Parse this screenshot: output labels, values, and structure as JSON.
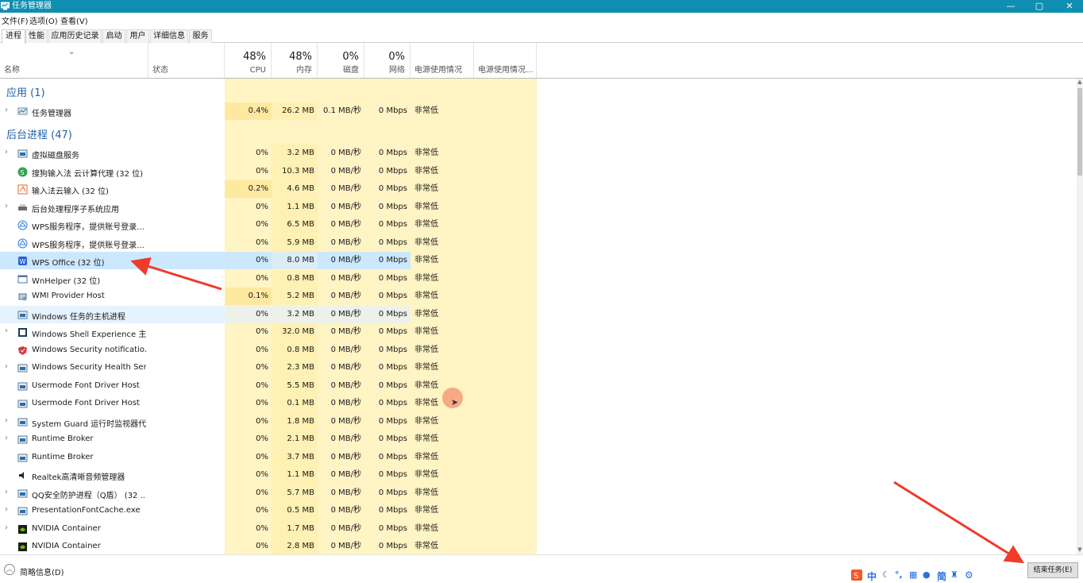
{
  "window": {
    "title": "任务管理器",
    "minimize": "—",
    "maximize": "▢",
    "close": "✕"
  },
  "menu": [
    "文件(F)",
    "选项(O)",
    "查看(V)"
  ],
  "tabs": [
    "进程",
    "性能",
    "应用历史记录",
    "启动",
    "用户",
    "详细信息",
    "服务"
  ],
  "active_tab": "进程",
  "columns": {
    "name": "名称",
    "status": "状态",
    "cpu": {
      "pct": "48%",
      "label": "CPU"
    },
    "memory": {
      "pct": "48%",
      "label": "内存"
    },
    "disk": {
      "pct": "0%",
      "label": "磁盘"
    },
    "network": {
      "pct": "0%",
      "label": "网络"
    },
    "power": "电源使用情况",
    "power_trend": "电源使用情况..."
  },
  "groups": {
    "apps": "应用 (1)",
    "background": "后台进程 (47)"
  },
  "rows": [
    {
      "kind": "app",
      "name": "任务管理器",
      "icon": "task-manager-icon",
      "expand": true,
      "cpu": "0.4%",
      "mem": "26.2 MB",
      "disk": "0.1 MB/秒",
      "net": "0 Mbps",
      "power": "非常低"
    },
    {
      "kind": "bg",
      "name": "虚拟磁盘服务",
      "icon": "service-icon",
      "expand": true,
      "cpu": "0%",
      "mem": "3.2 MB",
      "disk": "0 MB/秒",
      "net": "0 Mbps",
      "power": "非常低"
    },
    {
      "kind": "bg",
      "name": "搜狗输入法 云计算代理 (32 位)",
      "icon": "sogou-icon",
      "expand": false,
      "cpu": "0%",
      "mem": "10.3 MB",
      "disk": "0 MB/秒",
      "net": "0 Mbps",
      "power": "非常低"
    },
    {
      "kind": "bg",
      "name": "输入法云输入 (32 位)",
      "icon": "ime-cloud-icon",
      "expand": false,
      "cpu": "0.2%",
      "mem": "4.6 MB",
      "disk": "0 MB/秒",
      "net": "0 Mbps",
      "power": "非常低"
    },
    {
      "kind": "bg",
      "name": "后台处理程序子系统应用",
      "icon": "printer-icon",
      "expand": true,
      "cpu": "0%",
      "mem": "1.1 MB",
      "disk": "0 MB/秒",
      "net": "0 Mbps",
      "power": "非常低"
    },
    {
      "kind": "bg",
      "name": "WPS服务程序，提供账号登录...",
      "icon": "wps-cloud-icon",
      "expand": false,
      "cpu": "0%",
      "mem": "6.5 MB",
      "disk": "0 MB/秒",
      "net": "0 Mbps",
      "power": "非常低"
    },
    {
      "kind": "bg",
      "name": "WPS服务程序，提供账号登录...",
      "icon": "wps-cloud-icon",
      "expand": false,
      "cpu": "0%",
      "mem": "5.9 MB",
      "disk": "0 MB/秒",
      "net": "0 Mbps",
      "power": "非常低"
    },
    {
      "kind": "bg",
      "name": "WPS Office (32 位)",
      "icon": "wps-office-icon",
      "expand": false,
      "cpu": "0%",
      "mem": "8.0 MB",
      "disk": "0 MB/秒",
      "net": "0 Mbps",
      "power": "非常低",
      "selected": true
    },
    {
      "kind": "bg",
      "name": "WnHelper (32 位)",
      "icon": "window-icon",
      "expand": false,
      "cpu": "0%",
      "mem": "0.8 MB",
      "disk": "0 MB/秒",
      "net": "0 Mbps",
      "power": "非常低"
    },
    {
      "kind": "bg",
      "name": "WMI Provider Host",
      "icon": "wmi-icon",
      "expand": false,
      "cpu": "0.1%",
      "mem": "5.2 MB",
      "disk": "0 MB/秒",
      "net": "0 Mbps",
      "power": "非常低"
    },
    {
      "kind": "bg",
      "name": "Windows 任务的主机进程",
      "icon": "service-icon",
      "expand": false,
      "cpu": "0%",
      "mem": "3.2 MB",
      "disk": "0 MB/秒",
      "net": "0 Mbps",
      "power": "非常低",
      "hover": true
    },
    {
      "kind": "bg",
      "name": "Windows Shell Experience 主机",
      "icon": "shell-icon",
      "expand": true,
      "cpu": "0%",
      "mem": "32.0 MB",
      "disk": "0 MB/秒",
      "net": "0 Mbps",
      "power": "非常低"
    },
    {
      "kind": "bg",
      "name": "Windows Security notificatio...",
      "icon": "security-notify-icon",
      "expand": false,
      "cpu": "0%",
      "mem": "0.8 MB",
      "disk": "0 MB/秒",
      "net": "0 Mbps",
      "power": "非常低"
    },
    {
      "kind": "bg",
      "name": "Windows Security Health Ser...",
      "icon": "service-icon",
      "expand": true,
      "cpu": "0%",
      "mem": "2.3 MB",
      "disk": "0 MB/秒",
      "net": "0 Mbps",
      "power": "非常低"
    },
    {
      "kind": "bg",
      "name": "Usermode Font Driver Host",
      "icon": "service-icon",
      "expand": false,
      "cpu": "0%",
      "mem": "5.5 MB",
      "disk": "0 MB/秒",
      "net": "0 Mbps",
      "power": "非常低"
    },
    {
      "kind": "bg",
      "name": "Usermode Font Driver Host",
      "icon": "service-icon",
      "expand": false,
      "cpu": "0%",
      "mem": "0.1 MB",
      "disk": "0 MB/秒",
      "net": "0 Mbps",
      "power": "非常低"
    },
    {
      "kind": "bg",
      "name": "System Guard 运行时监视器代...",
      "icon": "service-icon",
      "expand": true,
      "cpu": "0%",
      "mem": "1.8 MB",
      "disk": "0 MB/秒",
      "net": "0 Mbps",
      "power": "非常低"
    },
    {
      "kind": "bg",
      "name": "Runtime Broker",
      "icon": "service-icon",
      "expand": true,
      "cpu": "0%",
      "mem": "2.1 MB",
      "disk": "0 MB/秒",
      "net": "0 Mbps",
      "power": "非常低"
    },
    {
      "kind": "bg",
      "name": "Runtime Broker",
      "icon": "service-icon",
      "expand": false,
      "cpu": "0%",
      "mem": "3.7 MB",
      "disk": "0 MB/秒",
      "net": "0 Mbps",
      "power": "非常低"
    },
    {
      "kind": "bg",
      "name": "Realtek高清晰音频管理器",
      "icon": "speaker-icon",
      "expand": false,
      "cpu": "0%",
      "mem": "1.1 MB",
      "disk": "0 MB/秒",
      "net": "0 Mbps",
      "power": "非常低"
    },
    {
      "kind": "bg",
      "name": "QQ安全防护进程（Q盾） (32 ...",
      "icon": "service-icon",
      "expand": true,
      "cpu": "0%",
      "mem": "5.7 MB",
      "disk": "0 MB/秒",
      "net": "0 Mbps",
      "power": "非常低"
    },
    {
      "kind": "bg",
      "name": "PresentationFontCache.exe",
      "icon": "service-icon",
      "expand": true,
      "cpu": "0%",
      "mem": "0.5 MB",
      "disk": "0 MB/秒",
      "net": "0 Mbps",
      "power": "非常低"
    },
    {
      "kind": "bg",
      "name": "NVIDIA Container",
      "icon": "nvidia-icon",
      "expand": true,
      "cpu": "0%",
      "mem": "1.7 MB",
      "disk": "0 MB/秒",
      "net": "0 Mbps",
      "power": "非常低"
    },
    {
      "kind": "bg",
      "name": "NVIDIA Container",
      "icon": "nvidia-icon",
      "expand": false,
      "cpu": "0%",
      "mem": "2.8 MB",
      "disk": "0 MB/秒",
      "net": "0 Mbps",
      "power": "非常低"
    }
  ],
  "footer": {
    "fewer_details": "简略信息(D)",
    "end_task": "结束任务(E)"
  },
  "ime_tray": {
    "lang": "中",
    "mode": "简"
  },
  "colors": {
    "titlebar": "#0e8fb1",
    "heat": "#fff4c4",
    "heat_high": "#fde9a0",
    "selected": "#cce8ff",
    "group_title": "#1f5fa8",
    "arrow": "#f03a2a"
  }
}
